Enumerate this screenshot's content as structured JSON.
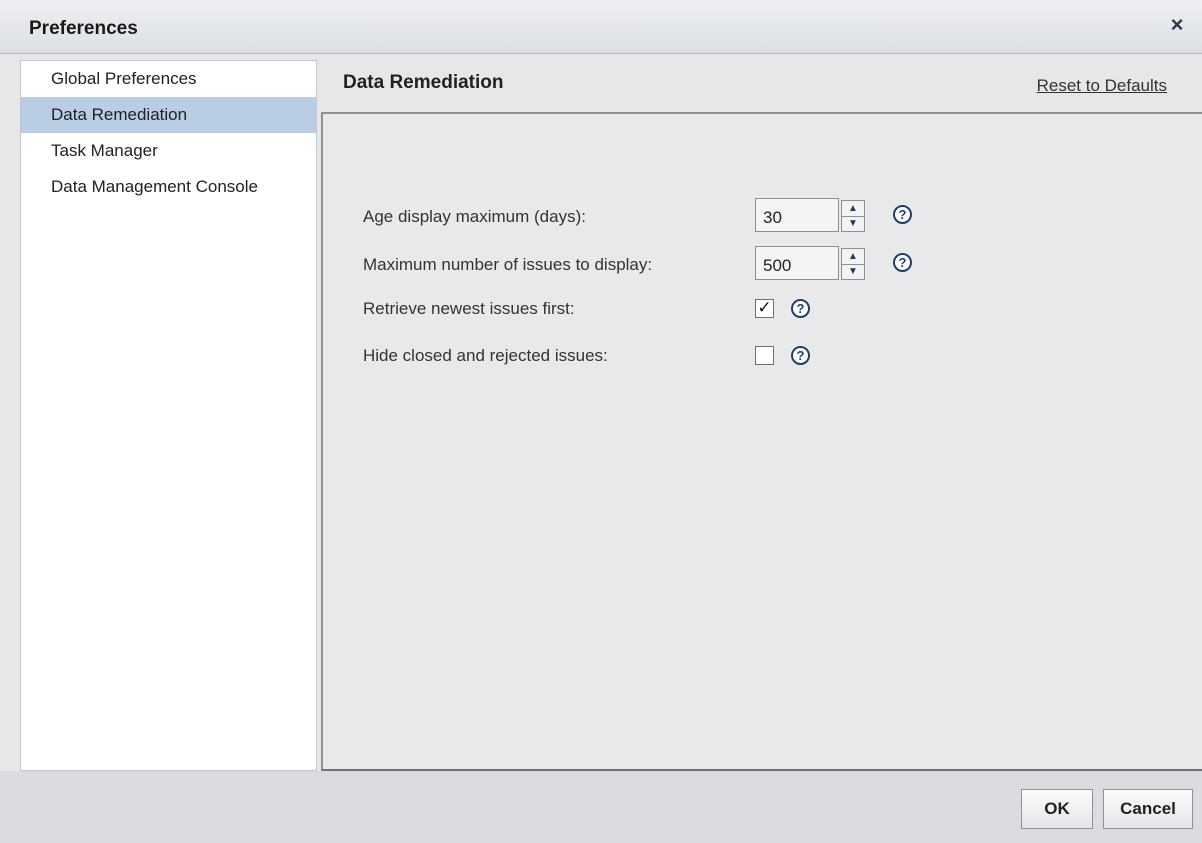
{
  "dialog": {
    "title": "Preferences",
    "close_label": "×"
  },
  "sidebar": {
    "items": [
      {
        "label": "Global Preferences"
      },
      {
        "label": "Data Remediation",
        "selected": true
      },
      {
        "label": "Task Manager"
      },
      {
        "label": "Data Management Console"
      }
    ]
  },
  "main": {
    "section_title": "Data Remediation",
    "reset_label": "Reset to Defaults",
    "settings": [
      {
        "label": "Age display maximum (days):",
        "type": "spinner",
        "value": "30"
      },
      {
        "label": "Maximum number of issues to display:",
        "type": "spinner",
        "value": "500"
      },
      {
        "label": "Retrieve newest issues first:",
        "type": "checkbox",
        "checked": true
      },
      {
        "label": "Hide closed and rejected issues:",
        "type": "checkbox",
        "checked": false
      }
    ]
  },
  "footer": {
    "ok_label": "OK",
    "cancel_label": "Cancel"
  },
  "icons": {
    "help": "?",
    "check": "✓",
    "spin_up": "▲",
    "spin_down": "▼"
  }
}
